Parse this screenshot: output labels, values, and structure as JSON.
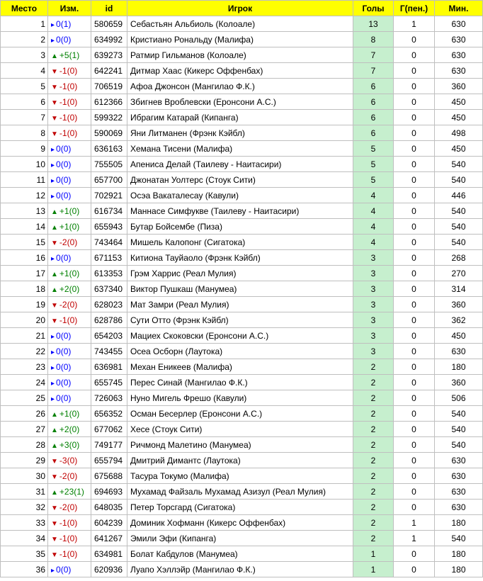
{
  "headers": {
    "place": "Место",
    "change": "Изм.",
    "id": "id",
    "player": "Игрок",
    "goals": "Голы",
    "pen": "Г(пен.)",
    "min": "Мин."
  },
  "colors": {
    "header_bg": "#ffff00",
    "goals_bg": "#c6efce",
    "up": "#008000",
    "down": "#c00000",
    "same": "#0000ff"
  },
  "icons": {
    "up": "triangle-up-icon",
    "down": "triangle-down-icon",
    "same": "triangle-right-icon"
  },
  "rows": [
    {
      "place": "1",
      "dir": "same",
      "change": "0(1)",
      "id": "580659",
      "player": "Себастьян Альбиоль (Колоале)",
      "goals": "13",
      "pen": "1",
      "min": "630"
    },
    {
      "place": "2",
      "dir": "same",
      "change": "0(0)",
      "id": "634992",
      "player": "Кристиано Рональду (Малифа)",
      "goals": "8",
      "pen": "0",
      "min": "630"
    },
    {
      "place": "3",
      "dir": "up",
      "change": "+5(1)",
      "id": "639273",
      "player": "Ратмир Гильманов (Колоале)",
      "goals": "7",
      "pen": "0",
      "min": "630"
    },
    {
      "place": "4",
      "dir": "down",
      "change": "-1(0)",
      "id": "642241",
      "player": "Дитмар Хаас (Кикерс Оффенбах)",
      "goals": "7",
      "pen": "0",
      "min": "630"
    },
    {
      "place": "5",
      "dir": "down",
      "change": "-1(0)",
      "id": "706519",
      "player": "Афоа Джонсон (Мангилао Ф.К.)",
      "goals": "6",
      "pen": "0",
      "min": "360"
    },
    {
      "place": "6",
      "dir": "down",
      "change": "-1(0)",
      "id": "612366",
      "player": "Збигнев Вроблевски (Еронсони А.С.)",
      "goals": "6",
      "pen": "0",
      "min": "450"
    },
    {
      "place": "7",
      "dir": "down",
      "change": "-1(0)",
      "id": "599322",
      "player": "Ибрагим Катарай (Кипанга)",
      "goals": "6",
      "pen": "0",
      "min": "450"
    },
    {
      "place": "8",
      "dir": "down",
      "change": "-1(0)",
      "id": "590069",
      "player": "Яни Литманен (Фрэнк Кэйбл)",
      "goals": "6",
      "pen": "0",
      "min": "498"
    },
    {
      "place": "9",
      "dir": "same",
      "change": "0(0)",
      "id": "636163",
      "player": "Хемана Тисени (Малифа)",
      "goals": "5",
      "pen": "0",
      "min": "450"
    },
    {
      "place": "10",
      "dir": "same",
      "change": "0(0)",
      "id": "755505",
      "player": "Апениса Делай (Таилеву - Наитасири)",
      "goals": "5",
      "pen": "0",
      "min": "540"
    },
    {
      "place": "11",
      "dir": "same",
      "change": "0(0)",
      "id": "657700",
      "player": "Джонатан Уолтерс (Стоук Сити)",
      "goals": "5",
      "pen": "0",
      "min": "540"
    },
    {
      "place": "12",
      "dir": "same",
      "change": "0(0)",
      "id": "702921",
      "player": "Осэа Вакаталесау (Кавули)",
      "goals": "4",
      "pen": "0",
      "min": "446"
    },
    {
      "place": "13",
      "dir": "up",
      "change": "+1(0)",
      "id": "616734",
      "player": "Маннасе Симфукве (Таилеву - Наитасири)",
      "goals": "4",
      "pen": "0",
      "min": "540"
    },
    {
      "place": "14",
      "dir": "up",
      "change": "+1(0)",
      "id": "655943",
      "player": "Бутар Бойсембе (Пиза)",
      "goals": "4",
      "pen": "0",
      "min": "540"
    },
    {
      "place": "15",
      "dir": "down",
      "change": "-2(0)",
      "id": "743464",
      "player": "Мишель Калопонг (Сигатока)",
      "goals": "4",
      "pen": "0",
      "min": "540"
    },
    {
      "place": "16",
      "dir": "same",
      "change": "0(0)",
      "id": "671153",
      "player": "Китиона Тауйаоло (Фрэнк Кэйбл)",
      "goals": "3",
      "pen": "0",
      "min": "268"
    },
    {
      "place": "17",
      "dir": "up",
      "change": "+1(0)",
      "id": "613353",
      "player": "Грэм Харрис (Реал Мулия)",
      "goals": "3",
      "pen": "0",
      "min": "270"
    },
    {
      "place": "18",
      "dir": "up",
      "change": "+2(0)",
      "id": "637340",
      "player": "Виктор Пушкаш (Манумеа)",
      "goals": "3",
      "pen": "0",
      "min": "314"
    },
    {
      "place": "19",
      "dir": "down",
      "change": "-2(0)",
      "id": "628023",
      "player": "Мат Замри (Реал Мулия)",
      "goals": "3",
      "pen": "0",
      "min": "360"
    },
    {
      "place": "20",
      "dir": "down",
      "change": "-1(0)",
      "id": "628786",
      "player": "Сути Отто (Фрэнк Кэйбл)",
      "goals": "3",
      "pen": "0",
      "min": "362"
    },
    {
      "place": "21",
      "dir": "same",
      "change": "0(0)",
      "id": "654203",
      "player": "Мациех Скоковски (Еронсони А.С.)",
      "goals": "3",
      "pen": "0",
      "min": "450"
    },
    {
      "place": "22",
      "dir": "same",
      "change": "0(0)",
      "id": "743455",
      "player": "Осеа Осборн (Лаутока)",
      "goals": "3",
      "pen": "0",
      "min": "630"
    },
    {
      "place": "23",
      "dir": "same",
      "change": "0(0)",
      "id": "636981",
      "player": "Механ Еникеев (Малифа)",
      "goals": "2",
      "pen": "0",
      "min": "180"
    },
    {
      "place": "24",
      "dir": "same",
      "change": "0(0)",
      "id": "655745",
      "player": "Перес Синай (Мангилао Ф.К.)",
      "goals": "2",
      "pen": "0",
      "min": "360"
    },
    {
      "place": "25",
      "dir": "same",
      "change": "0(0)",
      "id": "726063",
      "player": "Нуно Мигель Фрешо (Кавули)",
      "goals": "2",
      "pen": "0",
      "min": "506"
    },
    {
      "place": "26",
      "dir": "up",
      "change": "+1(0)",
      "id": "656352",
      "player": "Осман Бесерлер (Еронсони А.С.)",
      "goals": "2",
      "pen": "0",
      "min": "540"
    },
    {
      "place": "27",
      "dir": "up",
      "change": "+2(0)",
      "id": "677062",
      "player": "Хесе (Стоук Сити)",
      "goals": "2",
      "pen": "0",
      "min": "540"
    },
    {
      "place": "28",
      "dir": "up",
      "change": "+3(0)",
      "id": "749177",
      "player": "Ричмонд Малетино (Манумеа)",
      "goals": "2",
      "pen": "0",
      "min": "540"
    },
    {
      "place": "29",
      "dir": "down",
      "change": "-3(0)",
      "id": "655794",
      "player": "Дмитрий Димантс (Лаутока)",
      "goals": "2",
      "pen": "0",
      "min": "630"
    },
    {
      "place": "30",
      "dir": "down",
      "change": "-2(0)",
      "id": "675688",
      "player": "Тасура Токумо (Малифа)",
      "goals": "2",
      "pen": "0",
      "min": "630"
    },
    {
      "place": "31",
      "dir": "up",
      "change": "+23(1)",
      "id": "694693",
      "player": "Мухамад Файзаль Мухамад Азизул (Реал Мулия)",
      "goals": "2",
      "pen": "0",
      "min": "630"
    },
    {
      "place": "32",
      "dir": "down",
      "change": "-2(0)",
      "id": "648035",
      "player": "Петер Торсгард (Сигатока)",
      "goals": "2",
      "pen": "0",
      "min": "630"
    },
    {
      "place": "33",
      "dir": "down",
      "change": "-1(0)",
      "id": "604239",
      "player": "Доминик Хофманн (Кикерс Оффенбах)",
      "goals": "2",
      "pen": "1",
      "min": "180"
    },
    {
      "place": "34",
      "dir": "down",
      "change": "-1(0)",
      "id": "641267",
      "player": "Эмили Эфи (Кипанга)",
      "goals": "2",
      "pen": "1",
      "min": "540"
    },
    {
      "place": "35",
      "dir": "down",
      "change": "-1(0)",
      "id": "634981",
      "player": "Болат Кабдулов (Манумеа)",
      "goals": "1",
      "pen": "0",
      "min": "180"
    },
    {
      "place": "36",
      "dir": "same",
      "change": "0(0)",
      "id": "620936",
      "player": "Луапо Хэллэйр (Мангилао Ф.К.)",
      "goals": "1",
      "pen": "0",
      "min": "180"
    }
  ]
}
